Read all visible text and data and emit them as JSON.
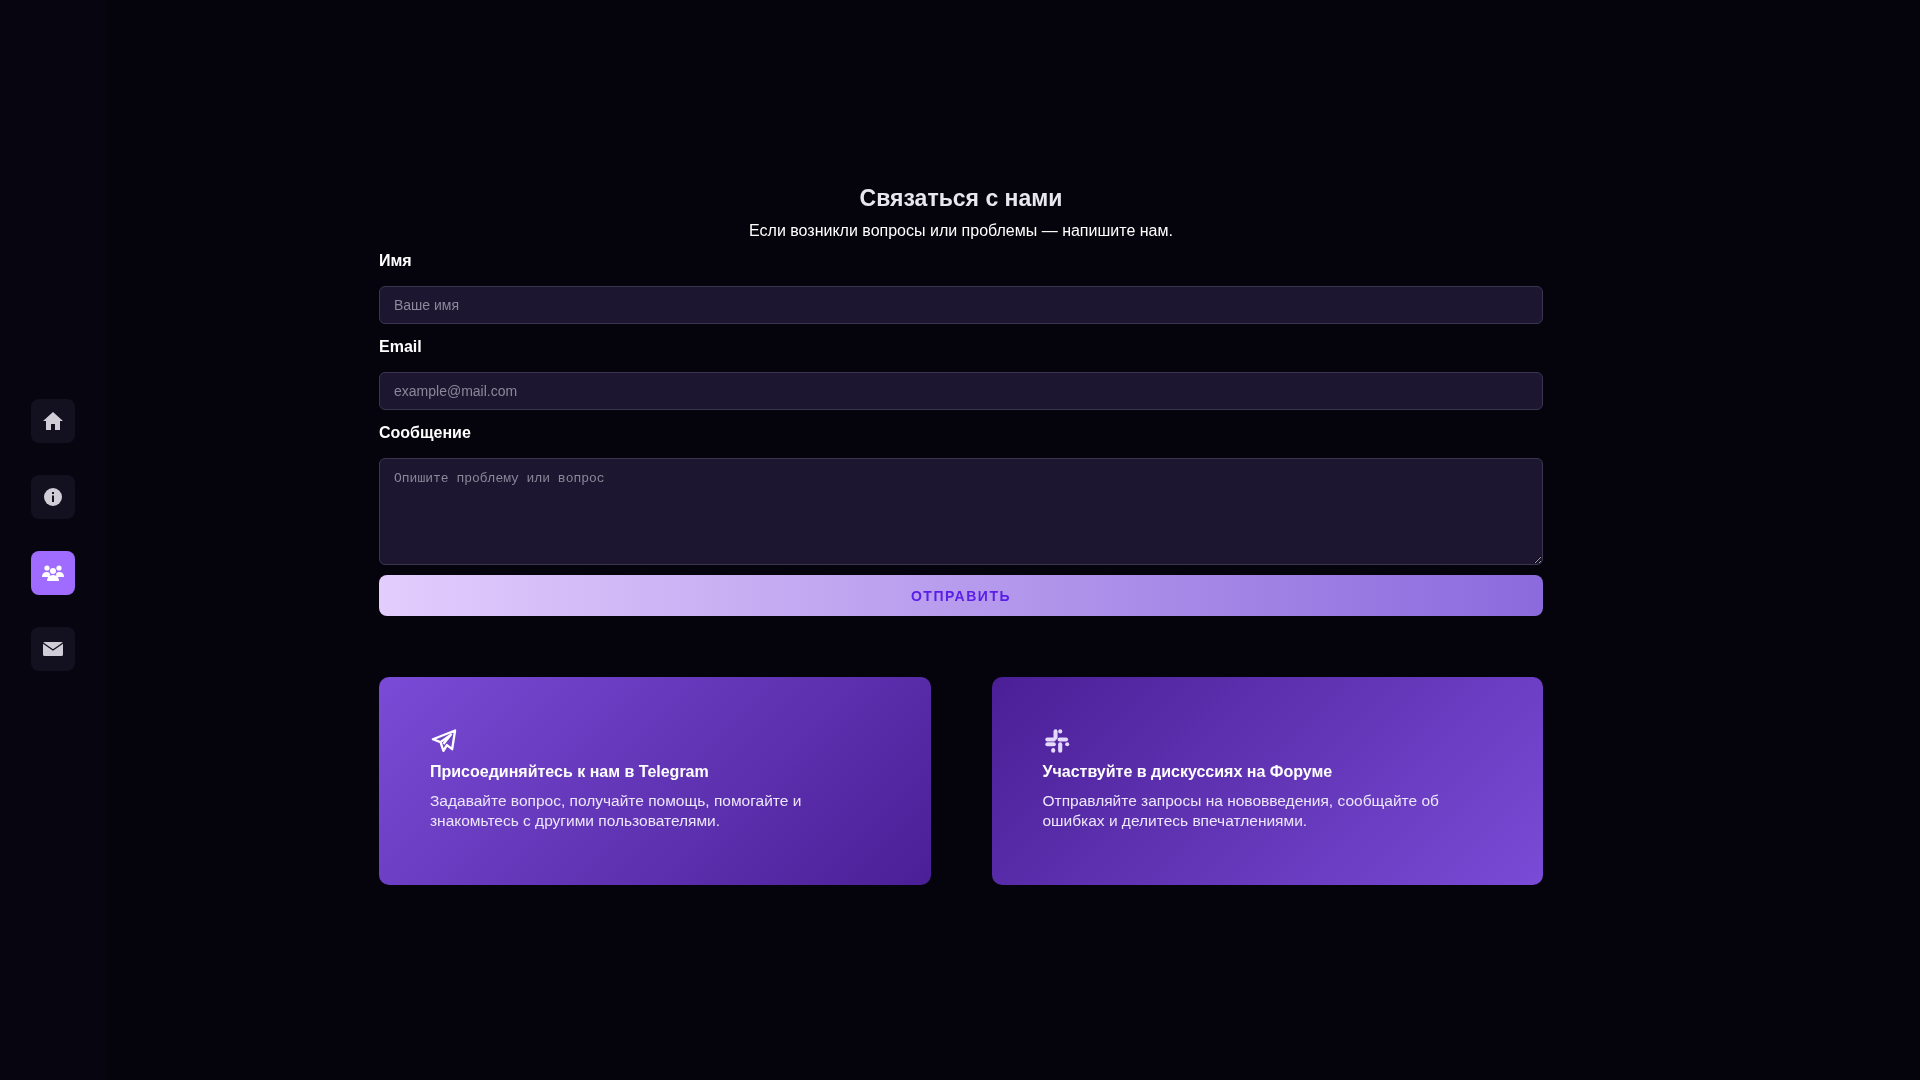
{
  "sidebar": {
    "items": [
      {
        "selected": false
      },
      {
        "selected": false
      },
      {
        "selected": true
      },
      {
        "selected": false
      }
    ]
  },
  "title": "Связаться с нами",
  "subtitle": "Если возникли вопросы или проблемы — напишите нам.",
  "form": {
    "fields": [
      {
        "label": "Имя",
        "placeholder": "Ваше имя",
        "kind": "input"
      },
      {
        "label": "Email",
        "placeholder": "example@mail.com",
        "kind": "input"
      },
      {
        "label": "Сообщение",
        "placeholder": "Опишите проблему или вопрос",
        "kind": "textarea"
      }
    ],
    "submit": "ОТПРАВИТЬ"
  },
  "cards": [
    {
      "title": "Присоединяйтесь к нам в Telegram",
      "text": "Задавайте вопрос, получайте помощь, помогайте и знакомьтесь с другими пользователями."
    },
    {
      "title": "Участвуйте в дискуссиях на Форуме",
      "text": "Отправляйте запросы на нововведения, сообщайте об ошибках и делитесь впечатлениями."
    }
  ]
}
